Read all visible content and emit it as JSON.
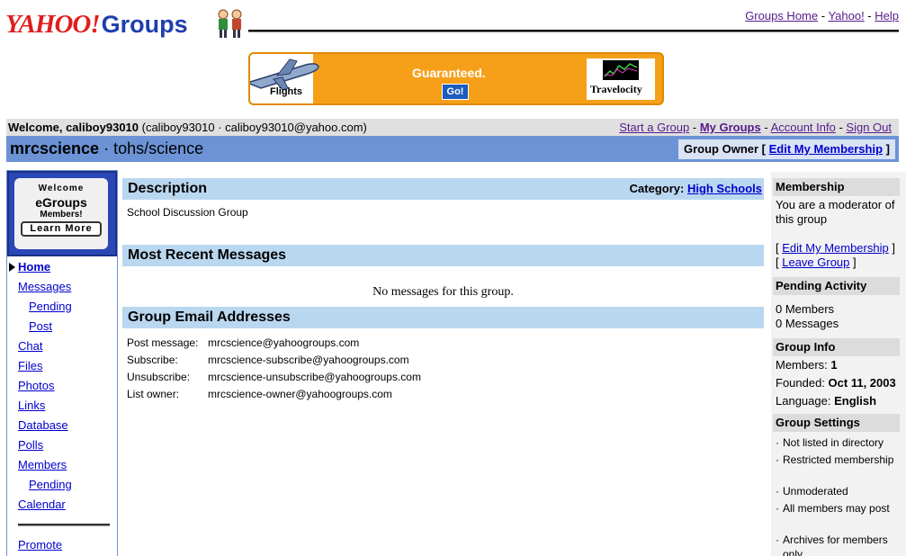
{
  "header": {
    "logo_yahoo": "YAHOO!",
    "logo_groups": "Groups",
    "links": [
      "Groups Home",
      "Yahoo!",
      "Help"
    ],
    "sep": " - "
  },
  "ad": {
    "left_label": "Flights",
    "tagline": "Guaranteed.",
    "go_button": "Go!",
    "brand": "Travelocity"
  },
  "welcome": {
    "prefix": "Welcome, ",
    "user": "caliboy93010",
    "detail": " (caliboy93010 · caliboy93010@yahoo.com)",
    "links": [
      "Start a Group",
      "My Groups",
      "Account Info",
      "Sign Out"
    ]
  },
  "group": {
    "name": "mrcscience",
    "path": " · tohs/science",
    "role": "Group Owner",
    "edit_membership": "Edit My Membership"
  },
  "sidebar": {
    "promo": {
      "welcome": "Welcome",
      "title": "eGroups",
      "members": "Members!",
      "learn_more": "Learn More"
    },
    "items": [
      {
        "label": "Home"
      },
      {
        "label": "Messages"
      },
      {
        "label": "Pending"
      },
      {
        "label": "Post"
      },
      {
        "label": "Chat"
      },
      {
        "label": "Files"
      },
      {
        "label": "Photos"
      },
      {
        "label": "Links"
      },
      {
        "label": "Database"
      },
      {
        "label": "Polls"
      },
      {
        "label": "Members"
      },
      {
        "label": "Pending"
      },
      {
        "label": "Calendar"
      },
      {
        "label": "Promote"
      }
    ]
  },
  "main": {
    "description": {
      "heading": "Description",
      "category_label": "Category: ",
      "category_value": "High Schools",
      "text": "School Discussion Group"
    },
    "recent": {
      "heading": "Most Recent Messages",
      "empty": "No messages for this group."
    },
    "emails": {
      "heading": "Group Email Addresses",
      "rows": [
        {
          "label": "Post message:",
          "value": "mrcscience@yahoogroups.com"
        },
        {
          "label": "Subscribe:",
          "value": "mrcscience-subscribe@yahoogroups.com"
        },
        {
          "label": "Unsubscribe:",
          "value": "mrcscience-unsubscribe@yahoogroups.com"
        },
        {
          "label": "List owner:",
          "value": "mrcscience-owner@yahoogroups.com"
        }
      ]
    }
  },
  "right": {
    "membership": {
      "heading": "Membership",
      "text": "You are a moderator of this group",
      "edit": "Edit My Membership",
      "leave": "Leave Group"
    },
    "pending": {
      "heading": "Pending Activity",
      "members": "0 Members",
      "messages": "0 Messages"
    },
    "info": {
      "heading": "Group Info",
      "members_label": "Members: ",
      "members_value": "1",
      "founded_label": "Founded: ",
      "founded_value": "Oct 11, 2003",
      "language_label": "Language: ",
      "language_value": "English"
    },
    "settings": {
      "heading": "Group Settings",
      "items": [
        "Not listed in directory",
        "Restricted membership",
        "Unmoderated",
        "All members may post",
        "Archives for members only"
      ]
    }
  },
  "colors": {
    "group_bar": "#6b93d6",
    "section_head": "#bad7f0",
    "link": "#0000cc",
    "logo_red": "#e01d1d",
    "logo_blue": "#1f3fae",
    "ad_orange": "#f6a01a"
  }
}
